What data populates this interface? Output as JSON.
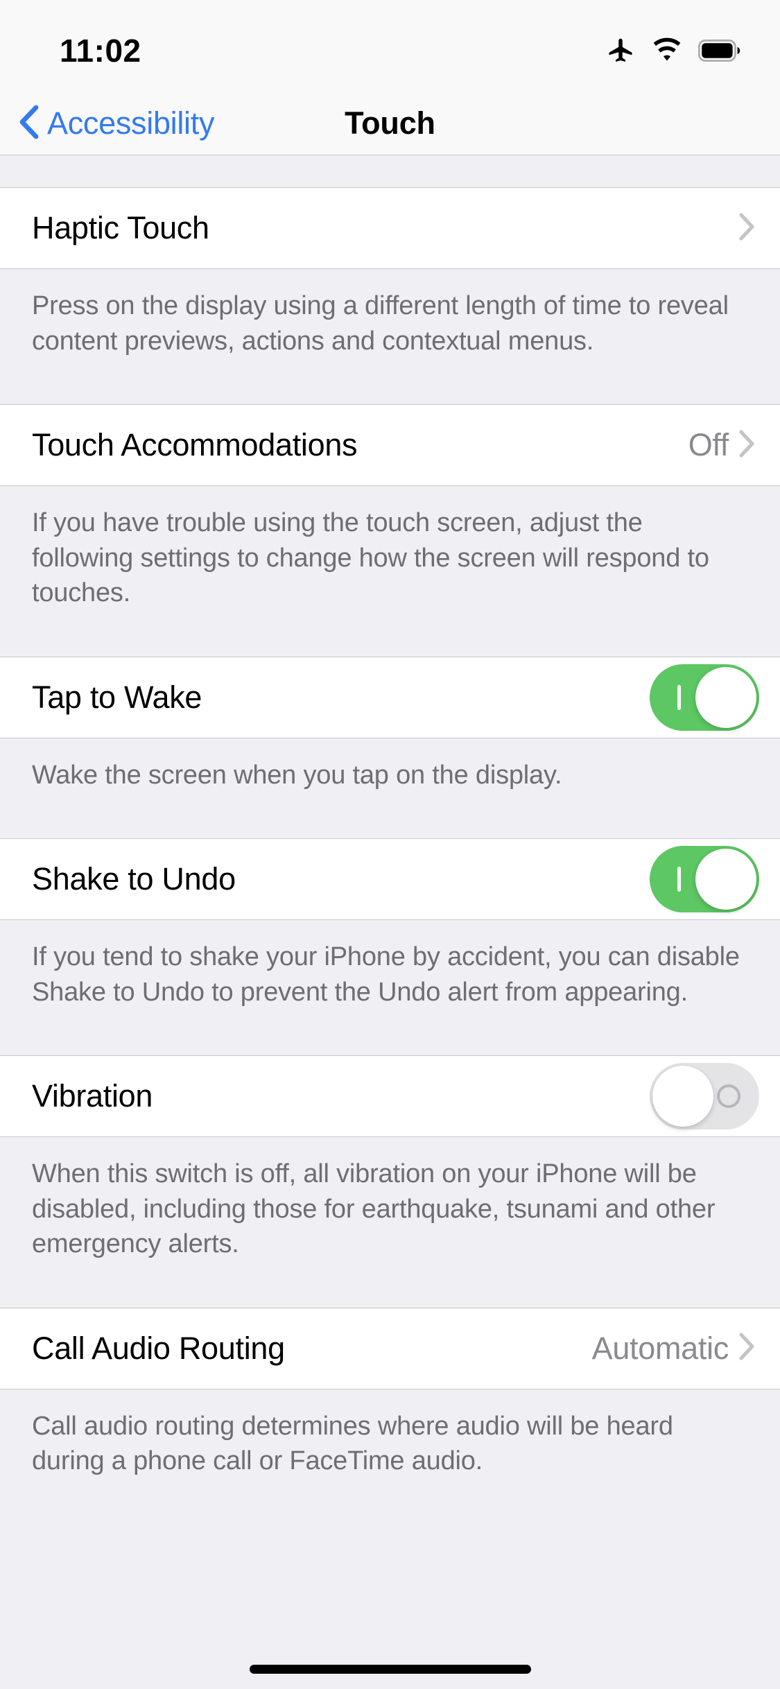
{
  "status_bar": {
    "time": "11:02",
    "icons": [
      "airplane-mode-icon",
      "wifi-icon",
      "battery-icon"
    ]
  },
  "nav": {
    "back_label": "Accessibility",
    "back_icon": "chevron-left-icon",
    "title": "Touch"
  },
  "colors": {
    "accent_blue": "#347AF0",
    "switch_on_green": "#5CC763",
    "switch_off_gray": "#E4E4E6",
    "group_background": "#EFEFF4",
    "cell_background": "#FFFFFF",
    "secondary_text": "#8A8A8E",
    "footer_text": "#6D6D72",
    "separator": "#C8C7CC"
  },
  "sections": [
    {
      "row": {
        "title": "Haptic Touch",
        "type": "disclosure",
        "value": "",
        "accessory_icon": "chevron-right-icon"
      },
      "footer": "Press on the display using a different length of time to reveal content previews, actions and contextual menus."
    },
    {
      "row": {
        "title": "Touch Accommodations",
        "type": "disclosure",
        "value": "Off",
        "accessory_icon": "chevron-right-icon"
      },
      "footer": "If you have trouble using the touch screen, adjust the following settings to change how the screen will respond to touches."
    },
    {
      "row": {
        "title": "Tap to Wake",
        "type": "switch",
        "switch_state": "on",
        "switch_glyph": "on-bar-glyph"
      },
      "footer": "Wake the screen when you tap on the display."
    },
    {
      "row": {
        "title": "Shake to Undo",
        "type": "switch",
        "switch_state": "on",
        "switch_glyph": "on-bar-glyph"
      },
      "footer": "If you tend to shake your iPhone by accident, you can disable Shake to Undo to prevent the Undo alert from appearing."
    },
    {
      "row": {
        "title": "Vibration",
        "type": "switch",
        "switch_state": "off",
        "switch_glyph": "off-circle-glyph"
      },
      "footer": "When this switch is off, all vibration on your iPhone will be disabled, including those for earthquake, tsunami and other emergency alerts."
    },
    {
      "row": {
        "title": "Call Audio Routing",
        "type": "disclosure",
        "value": "Automatic",
        "accessory_icon": "chevron-right-icon"
      },
      "footer": "Call audio routing determines where audio will be heard during a phone call or FaceTime audio."
    }
  ],
  "home_indicator": "home-indicator-bar"
}
